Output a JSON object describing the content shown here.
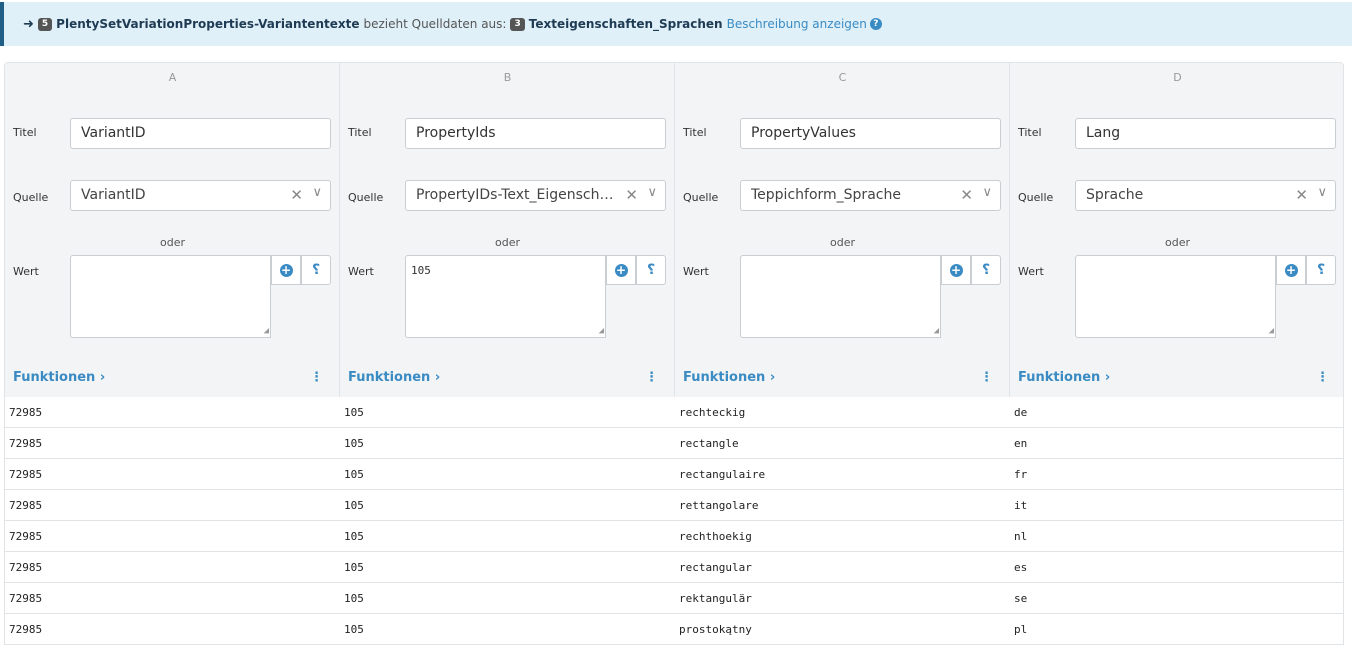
{
  "infobar": {
    "target_count": "5",
    "target_name": "PlentySetVariationProperties-Variantentexte",
    "relation_text": "bezieht Quelldaten aus:",
    "source_count": "3",
    "source_name": "Texteigenschaften_Sprachen",
    "description_link": "Beschreibung anzeigen"
  },
  "labels": {
    "titel": "Titel",
    "quelle": "Quelle",
    "wert": "Wert",
    "oder": "oder",
    "funktionen": "Funktionen"
  },
  "columns": [
    {
      "letter": "A",
      "title": "VariantID",
      "source": "VariantID",
      "value": "",
      "cells": [
        "72985",
        "72985",
        "72985",
        "72985",
        "72985",
        "72985",
        "72985",
        "72985"
      ]
    },
    {
      "letter": "B",
      "title": "PropertyIds",
      "source": "PropertyIDs-Text_Eigenschaft...",
      "value": "105",
      "cells": [
        "105",
        "105",
        "105",
        "105",
        "105",
        "105",
        "105",
        "105"
      ]
    },
    {
      "letter": "C",
      "title": "PropertyValues",
      "source": "Teppichform_Sprache",
      "value": "",
      "cells": [
        "rechteckig",
        "rectangle",
        "rectangulaire",
        "rettangolare",
        "rechthoekig",
        "rectangular",
        "rektangulär",
        "prostokątny"
      ]
    },
    {
      "letter": "D",
      "title": "Lang",
      "source": "Sprache",
      "value": "",
      "cells": [
        "de",
        "en",
        "fr",
        "it",
        "nl",
        "es",
        "se",
        "pl"
      ]
    }
  ],
  "colors": {
    "accent": "#3a8bc3",
    "info_bg": "#dff0f8",
    "header_bg": "#f2f4f5",
    "border": "#e1e4e6"
  }
}
